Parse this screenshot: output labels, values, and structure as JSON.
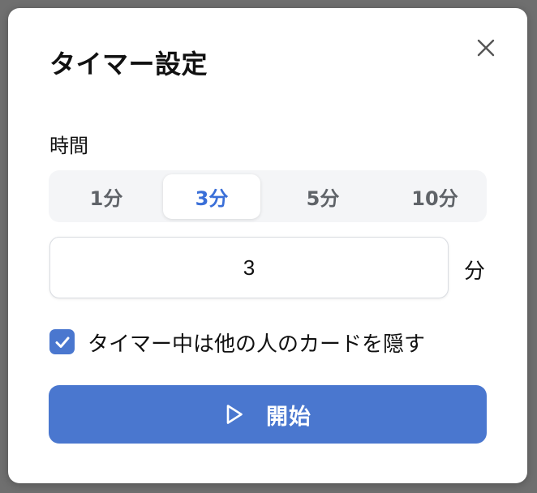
{
  "dialog": {
    "title": "タイマー設定",
    "close_icon": "close-icon"
  },
  "duration": {
    "label": "時間",
    "presets": [
      "1分",
      "3分",
      "5分",
      "10分"
    ],
    "selected_preset": "3分",
    "value": "3",
    "unit": "分"
  },
  "hide_cards": {
    "checked": true,
    "label": "タイマー中は他の人のカードを隠す"
  },
  "start": {
    "label": "開始",
    "icon": "play-icon"
  },
  "colors": {
    "accent": "#4a77cf",
    "active_segment_text": "#3a6fd8",
    "segment_bg": "#f4f5f7",
    "overlay": "#6f6f6f"
  }
}
